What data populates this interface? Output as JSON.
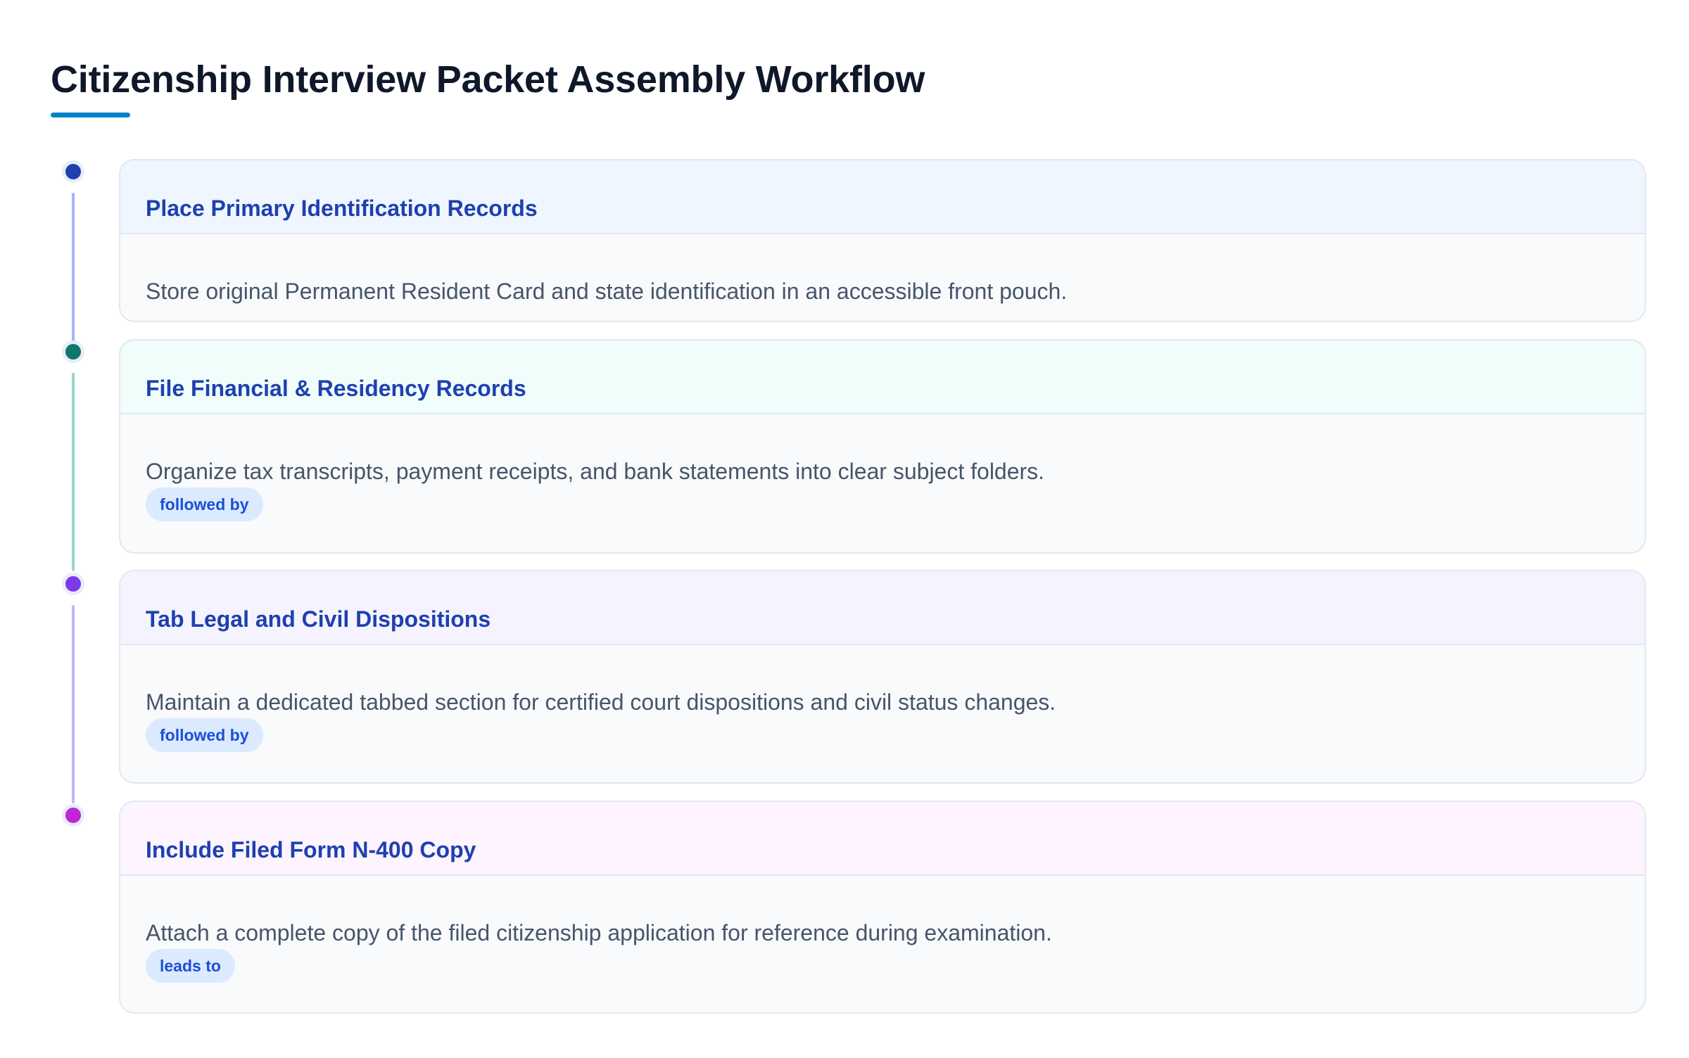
{
  "title": "Citizenship Interview Packet Assembly Workflow",
  "colors": {
    "accent_underline": "#0284c7",
    "step_title": "#1e40af",
    "badge_bg": "#dbeafe",
    "badge_text": "#1d4ed8"
  },
  "steps": [
    {
      "title": "Place Primary Identification Records",
      "description": "Store original Permanent Resident Card and state identification in an accessible front pouch.",
      "badge": "",
      "dot_color": "#1e40af",
      "line_color": "#a5b4fc",
      "header_bg": "#eff6ff"
    },
    {
      "title": "File Financial & Residency Records",
      "description": "Organize tax transcripts, payment receipts, and bank statements into clear subject folders.",
      "badge": "followed by",
      "dot_color": "#0f766e",
      "line_color": "#99d5cc",
      "header_bg": "#f0fdfa"
    },
    {
      "title": "Tab Legal and Civil Dispositions",
      "description": "Maintain a dedicated tabbed section for certified court dispositions and civil status changes.",
      "badge": "followed by",
      "dot_color": "#7c3aed",
      "line_color": "#c4b5fd",
      "header_bg": "#f5f3ff"
    },
    {
      "title": "Include Filed Form N-400 Copy",
      "description": "Attach a complete copy of the filed citizenship application for reference during examination.",
      "badge": "leads to",
      "dot_color": "#c026d3",
      "line_color": "",
      "header_bg": "#fdf4ff"
    }
  ]
}
